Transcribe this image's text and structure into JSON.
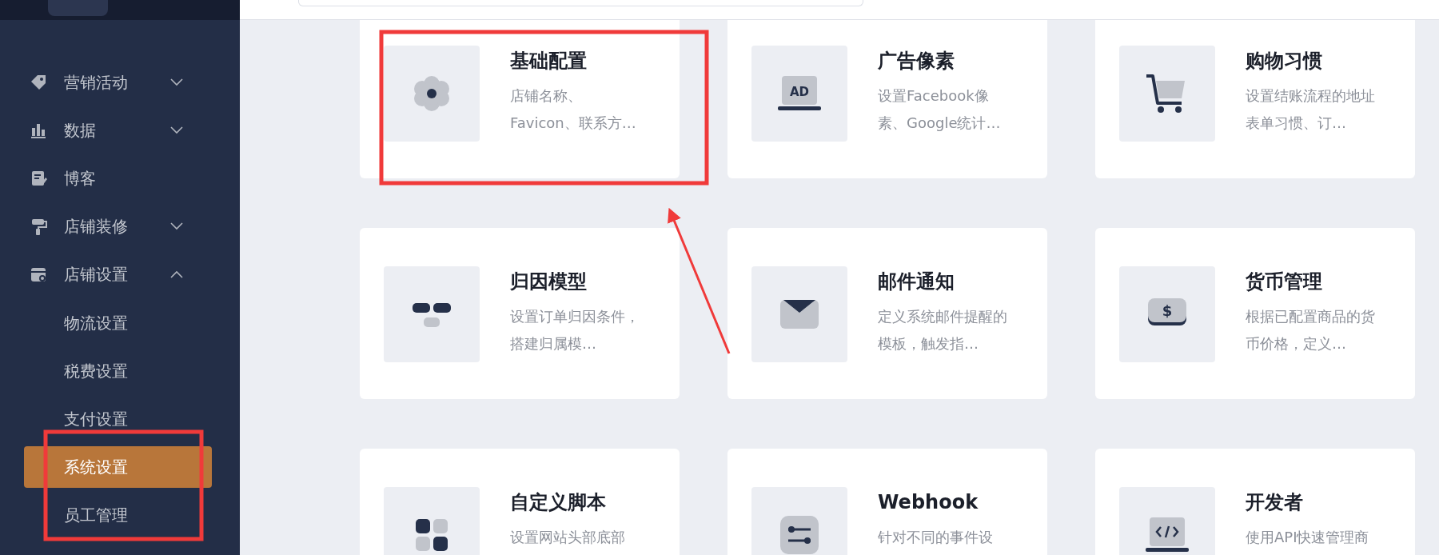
{
  "sidebar": {
    "items": [
      {
        "kind": "group",
        "label": "营销活动",
        "expanded": false
      },
      {
        "kind": "group",
        "label": "数据",
        "expanded": false
      },
      {
        "kind": "link",
        "label": "博客"
      },
      {
        "kind": "group",
        "label": "店铺装修",
        "expanded": false
      },
      {
        "kind": "group",
        "label": "店铺设置",
        "expanded": true,
        "children": [
          {
            "label": "物流设置",
            "selected": false
          },
          {
            "label": "税费设置",
            "selected": false
          },
          {
            "label": "支付设置",
            "selected": false
          },
          {
            "label": "系统设置",
            "selected": true
          },
          {
            "label": "员工管理",
            "selected": false
          }
        ]
      }
    ]
  },
  "settings_cards": [
    {
      "title": "基础配置",
      "description": "店铺名称、Favicon、联系方…"
    },
    {
      "title": "广告像素",
      "description": "设置Facebook像素、Google统计…",
      "icon_text": "AD"
    },
    {
      "title": "购物习惯",
      "description": "设置结账流程的地址表单习惯、订…"
    },
    {
      "title": "归因模型",
      "description": "设置订单归因条件，搭建归属模…"
    },
    {
      "title": "邮件通知",
      "description": "定义系统邮件提醒的模板，触发指…"
    },
    {
      "title": "货币管理",
      "description": "根据已配置商品的货币价格，定义…",
      "icon_text": "$"
    },
    {
      "title": "自定义脚本",
      "description": "设置网站头部底部"
    },
    {
      "title": "Webhook",
      "description": "针对不同的事件设"
    },
    {
      "title": "开发者",
      "description": "使用API快速管理商"
    }
  ]
}
